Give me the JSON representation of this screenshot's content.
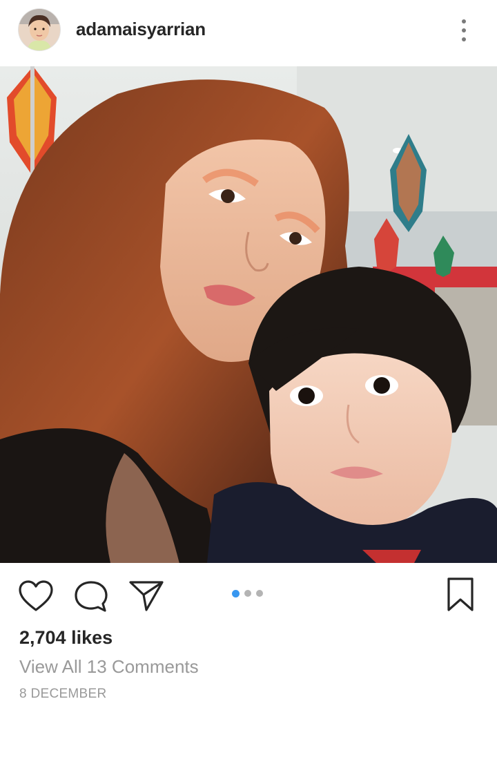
{
  "header": {
    "username": "adamaisyarrian",
    "avatar_icon": "profile-avatar",
    "more_icon": "vertical-dots-icon"
  },
  "post": {
    "photo_description_icon": "photo",
    "carousel": {
      "count": 3,
      "active_index": 0
    }
  },
  "actions": {
    "like_icon": "heart-icon",
    "comment_icon": "comment-icon",
    "share_icon": "paper-plane-icon",
    "save_icon": "bookmark-icon"
  },
  "stats": {
    "likes": "2,704 likes",
    "view_comments": "View All 13 Comments",
    "date": "8 DECEMBER"
  },
  "colors": {
    "accent_blue": "#3897f0",
    "text_primary": "#262626",
    "text_secondary": "#999999"
  }
}
